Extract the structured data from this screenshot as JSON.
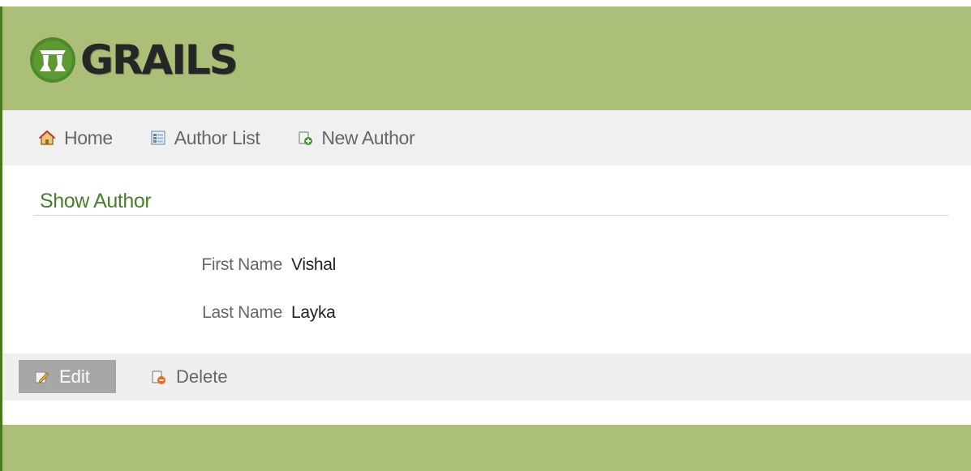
{
  "header": {
    "logo_text": "GRAILS",
    "logo_icon": "grails-cup-logo-icon"
  },
  "nav": {
    "items": [
      {
        "label": "Home",
        "icon": "home-icon"
      },
      {
        "label": "Author List",
        "icon": "list-icon"
      },
      {
        "label": "New Author",
        "icon": "new-document-icon"
      }
    ]
  },
  "main": {
    "title": "Show Author",
    "properties": [
      {
        "label": "First Name",
        "value": "Vishal"
      },
      {
        "label": "Last Name",
        "value": "Layka"
      }
    ]
  },
  "buttons": {
    "edit_label": "Edit",
    "delete_label": "Delete"
  },
  "colors": {
    "header_bg": "#abbf78",
    "accent_green": "#48802c",
    "nav_bg": "#f0f0f0",
    "edit_button_bg": "#a7a7a7"
  }
}
